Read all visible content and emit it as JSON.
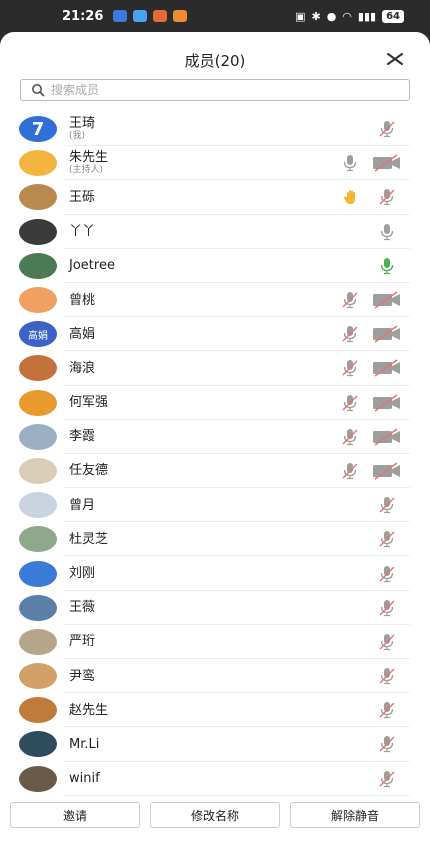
{
  "status_bar": {
    "time": "21:26",
    "battery": "64"
  },
  "panel": {
    "title": "成员(20)",
    "search_placeholder": "搜索成员"
  },
  "members": [
    {
      "name": "王琦",
      "sub": "(我)",
      "avatar_text": "7",
      "avatar_color": "#2f6fd6",
      "icons": [
        "mic-muted"
      ]
    },
    {
      "name": "朱先生",
      "sub": "(主持人)",
      "avatar_text": "",
      "avatar_color": "#f2b640",
      "icons": [
        "mic",
        "cam-off"
      ]
    },
    {
      "name": "王砾",
      "sub": "",
      "avatar_text": "",
      "avatar_color": "#b88a4e",
      "icons": [
        "hand",
        "mic-muted"
      ]
    },
    {
      "name": "丫丫",
      "sub": "",
      "avatar_text": "",
      "avatar_color": "#3a3a3a",
      "icons": [
        "mic"
      ]
    },
    {
      "name": "Joetree",
      "sub": "",
      "avatar_text": "",
      "avatar_color": "#4c7a55",
      "icons": [
        "mic-active"
      ]
    },
    {
      "name": "曾桃",
      "sub": "",
      "avatar_text": "",
      "avatar_color": "#f0a060",
      "icons": [
        "mic-muted",
        "cam-off"
      ]
    },
    {
      "name": "高娟",
      "sub": "",
      "avatar_text": "高娟",
      "avatar_color": "#3b63c4",
      "icons": [
        "mic-muted",
        "cam-off"
      ]
    },
    {
      "name": "海浪",
      "sub": "",
      "avatar_text": "",
      "avatar_color": "#c4703c",
      "icons": [
        "mic-muted",
        "cam-off"
      ]
    },
    {
      "name": "何军强",
      "sub": "",
      "avatar_text": "",
      "avatar_color": "#e89a2e",
      "icons": [
        "mic-muted",
        "cam-off"
      ]
    },
    {
      "name": "李霞",
      "sub": "",
      "avatar_text": "",
      "avatar_color": "#9bb0c4",
      "icons": [
        "mic-muted",
        "cam-off"
      ]
    },
    {
      "name": "任友德",
      "sub": "",
      "avatar_text": "",
      "avatar_color": "#d9cdb8",
      "icons": [
        "mic-muted",
        "cam-off"
      ]
    },
    {
      "name": "曾月",
      "sub": "",
      "avatar_text": "",
      "avatar_color": "#c9d4e0",
      "icons": [
        "mic-muted"
      ]
    },
    {
      "name": "杜灵芝",
      "sub": "",
      "avatar_text": "",
      "avatar_color": "#8fa88c",
      "icons": [
        "mic-muted"
      ]
    },
    {
      "name": "刘刚",
      "sub": "",
      "avatar_text": "",
      "avatar_color": "#3a7bd5",
      "icons": [
        "mic-muted"
      ]
    },
    {
      "name": "王薇",
      "sub": "",
      "avatar_text": "",
      "avatar_color": "#5a7fa8",
      "icons": [
        "mic-muted"
      ]
    },
    {
      "name": "严珩",
      "sub": "",
      "avatar_text": "",
      "avatar_color": "#b5a58a",
      "icons": [
        "mic-muted"
      ]
    },
    {
      "name": "尹鸾",
      "sub": "",
      "avatar_text": "",
      "avatar_color": "#d4a06a",
      "icons": [
        "mic-muted"
      ]
    },
    {
      "name": "赵先生",
      "sub": "",
      "avatar_text": "",
      "avatar_color": "#c07a3a",
      "icons": [
        "mic-muted"
      ]
    },
    {
      "name": "Mr.Li",
      "sub": "",
      "avatar_text": "",
      "avatar_color": "#2e4c5e",
      "icons": [
        "mic-muted"
      ]
    },
    {
      "name": "winif",
      "sub": "",
      "avatar_text": "",
      "avatar_color": "#6a5a4a",
      "icons": [
        "mic-muted"
      ]
    }
  ],
  "footer": {
    "invite_label": "邀请",
    "rename_label": "修改名称",
    "unmute_label": "解除静音"
  },
  "colors": {
    "muted_slash": "#e57373",
    "mic_active": "#4caf50",
    "hand": "#f5b730",
    "icon_gray": "#9e9e9e"
  }
}
